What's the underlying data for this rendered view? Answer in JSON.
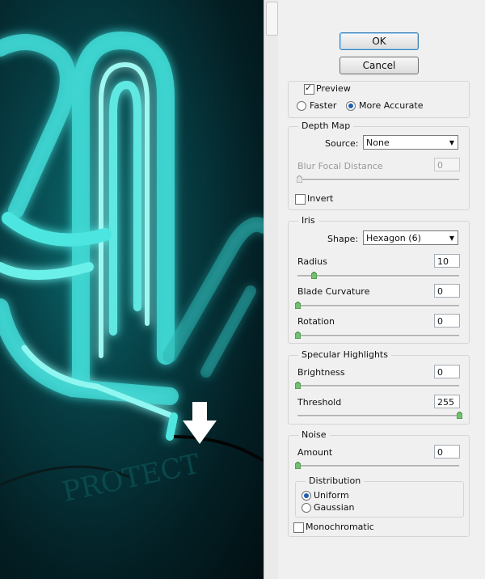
{
  "buttons": {
    "ok": "OK",
    "cancel": "Cancel"
  },
  "preview": {
    "checked": true,
    "label": "Preview",
    "faster": "Faster",
    "accurate": "More Accurate",
    "selected": "More Accurate"
  },
  "depth_map": {
    "title": "Depth Map",
    "source_label": "Source:",
    "source_value": "None",
    "blur_label": "Blur Focal Distance",
    "blur_value": "0",
    "invert_label": "Invert",
    "invert_checked": false
  },
  "iris": {
    "title": "Iris",
    "shape_label": "Shape:",
    "shape_value": "Hexagon (6)",
    "radius_label": "Radius",
    "radius_value": "10",
    "blade_label": "Blade Curvature",
    "blade_value": "0",
    "rotation_label": "Rotation",
    "rotation_value": "0"
  },
  "specular": {
    "title": "Specular Highlights",
    "brightness_label": "Brightness",
    "brightness_value": "0",
    "threshold_label": "Threshold",
    "threshold_value": "255"
  },
  "noise": {
    "title": "Noise",
    "amount_label": "Amount",
    "amount_value": "0",
    "distribution_title": "Distribution",
    "uniform": "Uniform",
    "gaussian": "Gaussian",
    "selected": "Uniform",
    "mono_label": "Monochromatic",
    "mono_checked": false
  },
  "colors": {
    "accent": "#3c7fb1",
    "neon": "#4fe6e0",
    "canvas_bg": "#04262b"
  }
}
